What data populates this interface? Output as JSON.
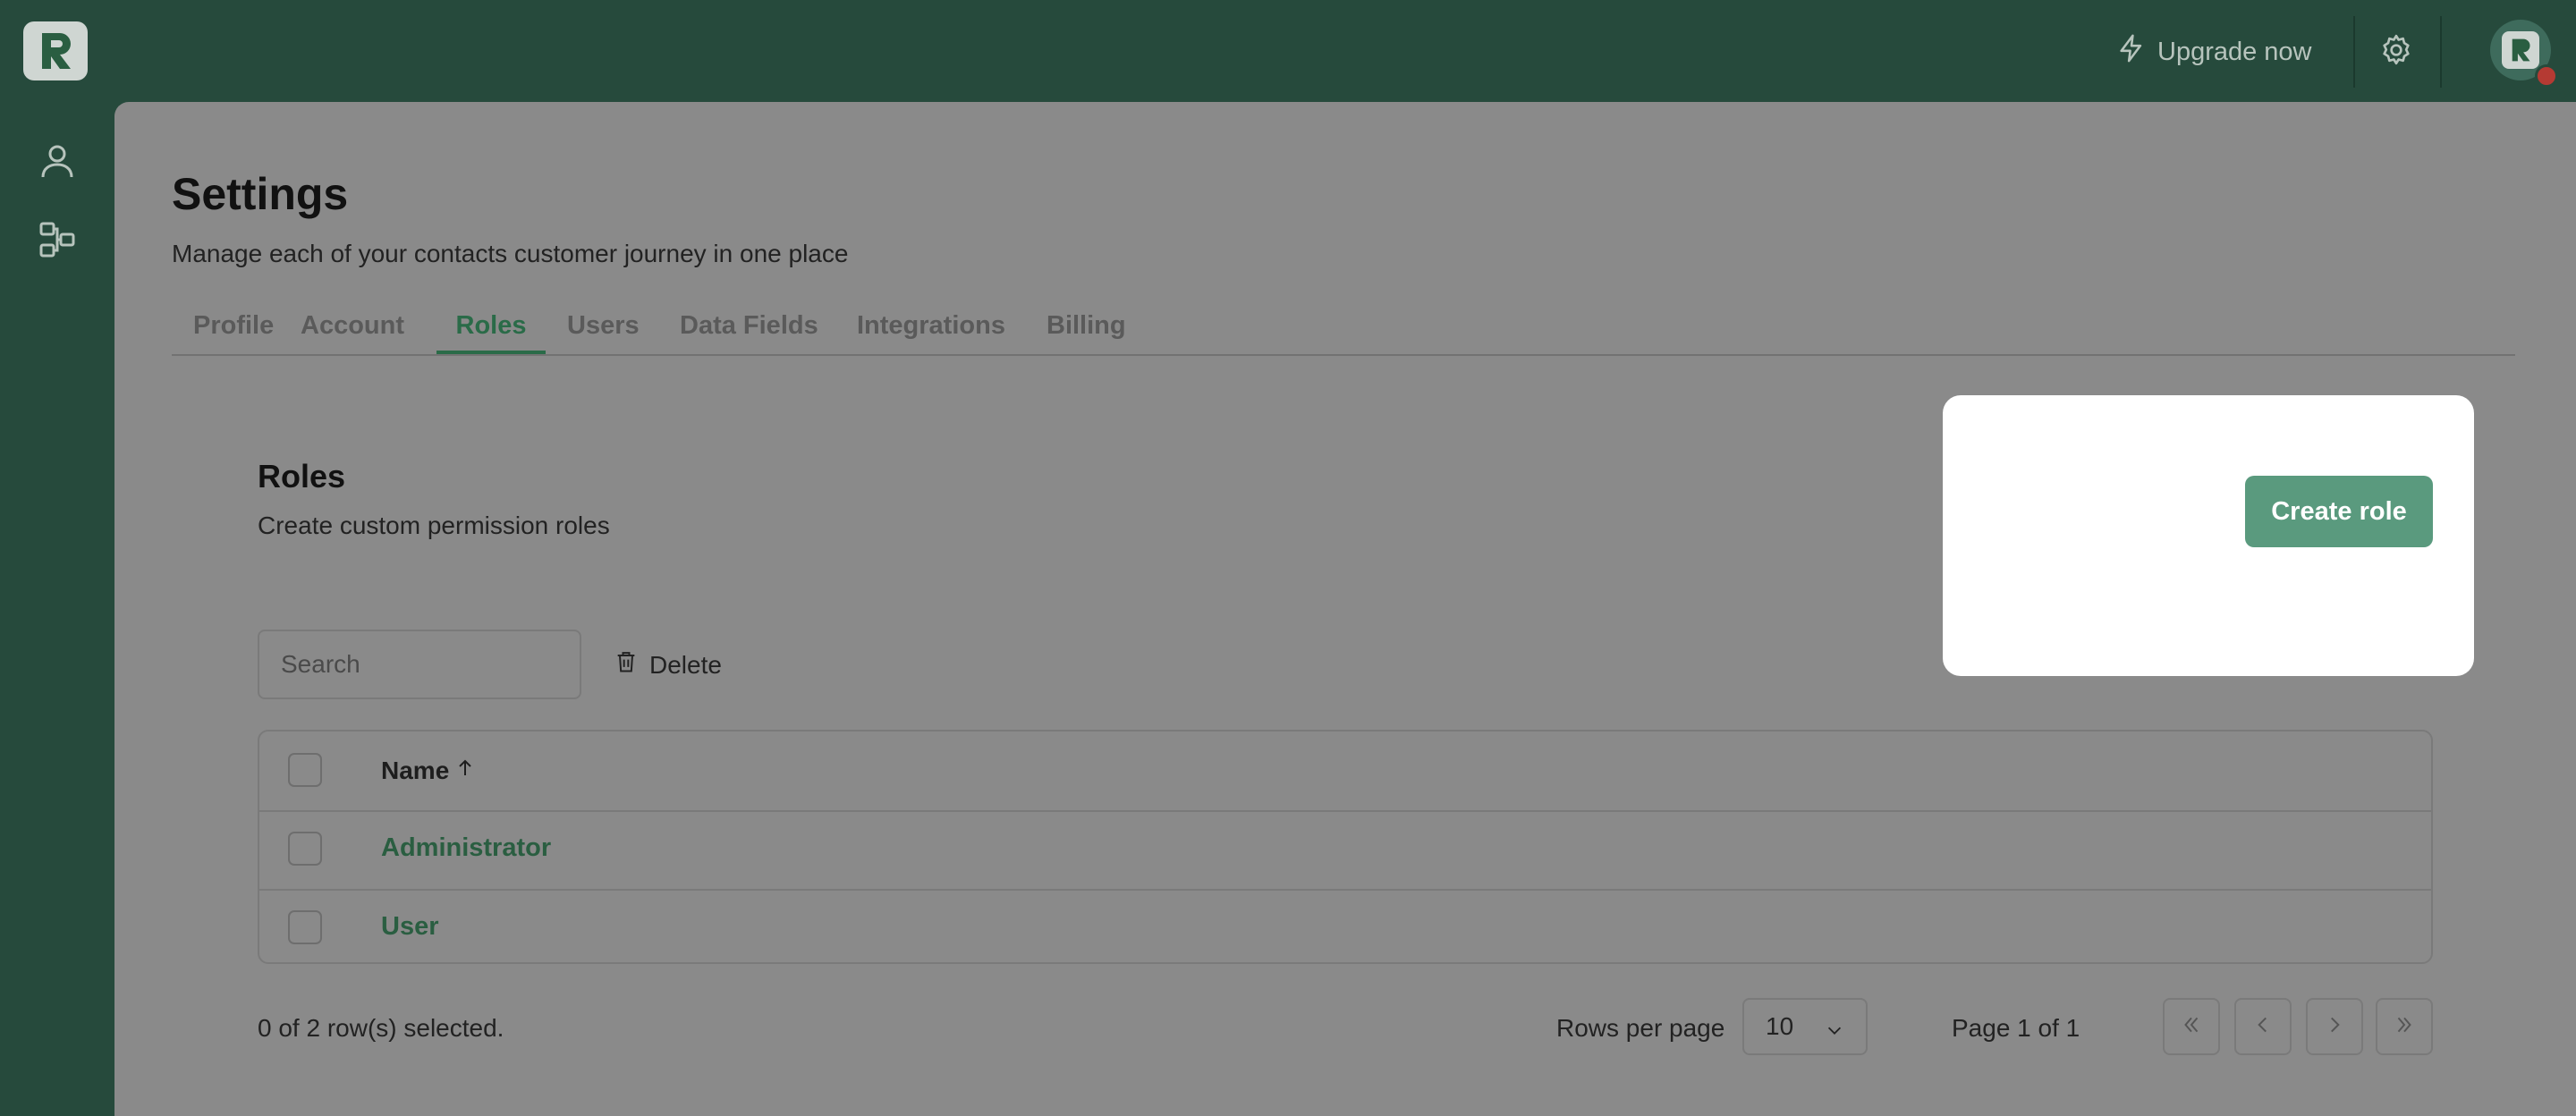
{
  "header": {
    "upgrade_label": "Upgrade now",
    "icons": [
      "lightning-icon",
      "gear-icon",
      "logo-r-icon"
    ]
  },
  "page": {
    "title": "Settings",
    "subtitle": "Manage each of your contacts customer journey in one place"
  },
  "tabs": [
    {
      "label": "Profile"
    },
    {
      "label": "Account"
    },
    {
      "label": "Roles",
      "active": true
    },
    {
      "label": "Users"
    },
    {
      "label": "Data Fields"
    },
    {
      "label": "Integrations"
    },
    {
      "label": "Billing"
    }
  ],
  "roles": {
    "title": "Roles",
    "subtitle": "Create custom permission roles",
    "search_placeholder": "Search",
    "delete_label": "Delete",
    "create_label": "Create role",
    "column_name": "Name",
    "rows": [
      {
        "name": "Administrator"
      },
      {
        "name": "User"
      }
    ],
    "selected_text": "0 of 2 row(s) selected.",
    "rows_per_page_label": "Rows per page",
    "rows_per_page_value": "10",
    "page_text": "Page 1 of 1"
  },
  "colors": {
    "sidebar": "#264a3c",
    "accent": "#2a6b48",
    "button": "#5a9a7e",
    "status": "#b53a33"
  }
}
